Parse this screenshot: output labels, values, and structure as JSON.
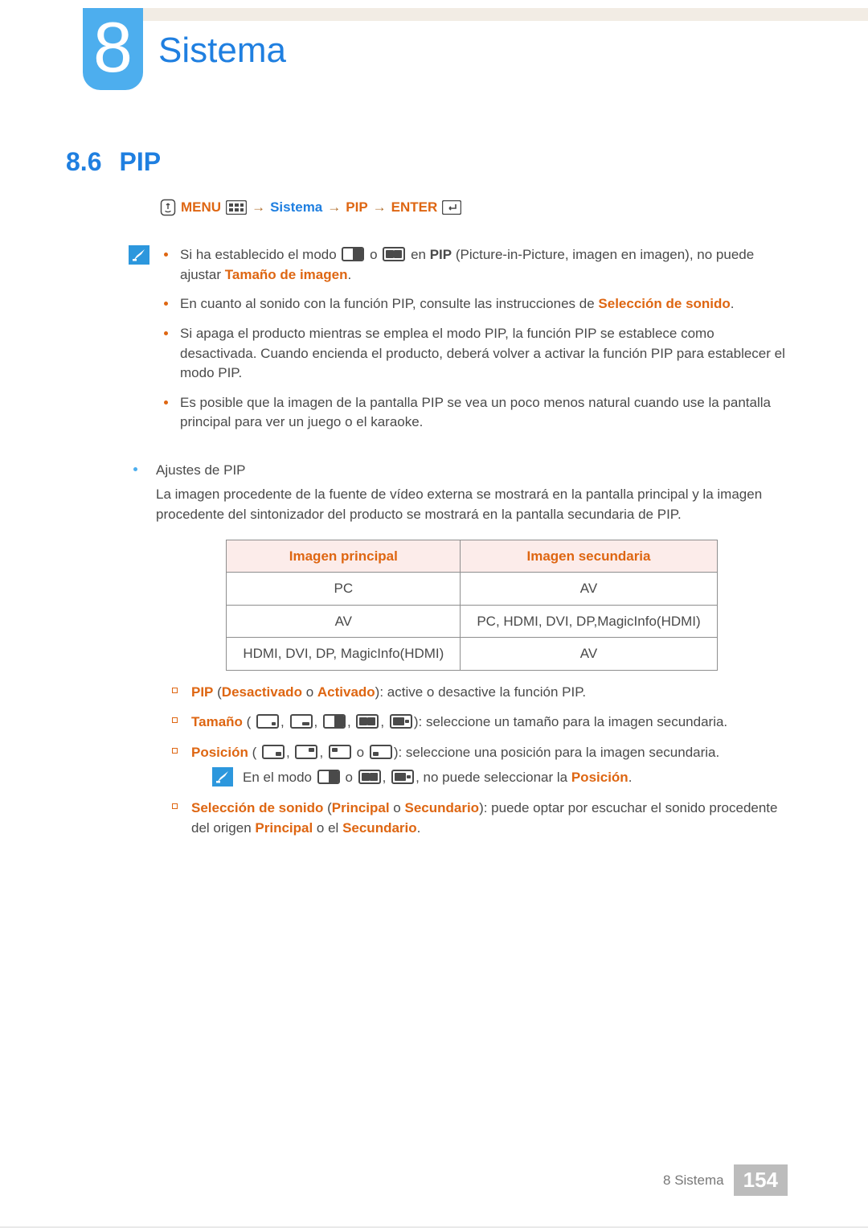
{
  "chapter": {
    "number": "8",
    "title": "Sistema"
  },
  "section": {
    "number": "8.6",
    "title": "PIP"
  },
  "nav": {
    "menu_label": "MENU",
    "arrow": "→",
    "system_label": "Sistema",
    "pip_label": "PIP",
    "enter_label": "ENTER"
  },
  "notes": {
    "n1_pre": "Si ha establecido el modo ",
    "n1_mid": " o ",
    "n1_post": " en ",
    "n1_pip": "PIP",
    "n1_after_pip": " (Picture-in-Picture, imagen en imagen), no puede ajustar ",
    "n1_link": "Tamaño de imagen",
    "n1_end": ".",
    "n2_pre": "En cuanto al sonido con la función PIP, consulte las instrucciones de ",
    "n2_link": "Selección de sonido",
    "n2_end": ".",
    "n3": "Si apaga el producto mientras se emplea el modo PIP, la función PIP se establece como desactivada. Cuando encienda el producto, deberá volver a activar la función PIP para establecer el modo PIP.",
    "n4": "Es posible que la imagen de la pantalla PIP se vea un poco menos natural cuando use la pantalla principal para ver un juego o el karaoke."
  },
  "outer": {
    "ajustes_title": "Ajustes de PIP",
    "ajustes_desc": "La imagen procedente de la fuente de vídeo externa se mostrará en la pantalla principal y la imagen procedente del sintonizador del producto se mostrará en la pantalla secundaria de PIP."
  },
  "table": {
    "h1": "Imagen principal",
    "h2": "Imagen secundaria",
    "rows": [
      {
        "c1": "PC",
        "c2": "AV"
      },
      {
        "c1": "AV",
        "c2": "PC, HDMI, DVI, DP,MagicInfo(HDMI)"
      },
      {
        "c1": "HDMI, DVI, DP, MagicInfo(HDMI)",
        "c2": "AV"
      }
    ]
  },
  "sub": {
    "pip_label": "PIP",
    "pip_opts_open": " (",
    "pip_off": "Desactivado",
    "pip_or": " o ",
    "pip_on": "Activado",
    "pip_close": "): active o desactive la función PIP.",
    "size_label": "Tamaño",
    "size_open": " (",
    "size_close": "): seleccione un tamaño para la imagen secundaria.",
    "pos_label": "Posición",
    "pos_open": " (",
    "pos_or": " o ",
    "pos_close": "): seleccione una posición para la imagen secundaria.",
    "inner_pre": "En el modo ",
    "inner_or": " o ",
    "inner_comma": ", ",
    "inner_mid": ", no puede seleccionar la ",
    "inner_link": "Posición",
    "inner_end": ".",
    "sound_label": "Selección de sonido",
    "sound_open": " (",
    "sound_p": "Principal",
    "sound_or": " o ",
    "sound_s": "Secundario",
    "sound_close": "): puede optar por escuchar el sonido procedente del origen ",
    "sound_p2": "Principal",
    "sound_mid": " o el ",
    "sound_s2": "Secundario",
    "sound_end": "."
  },
  "footer": {
    "label": "8 Sistema",
    "page": "154"
  }
}
